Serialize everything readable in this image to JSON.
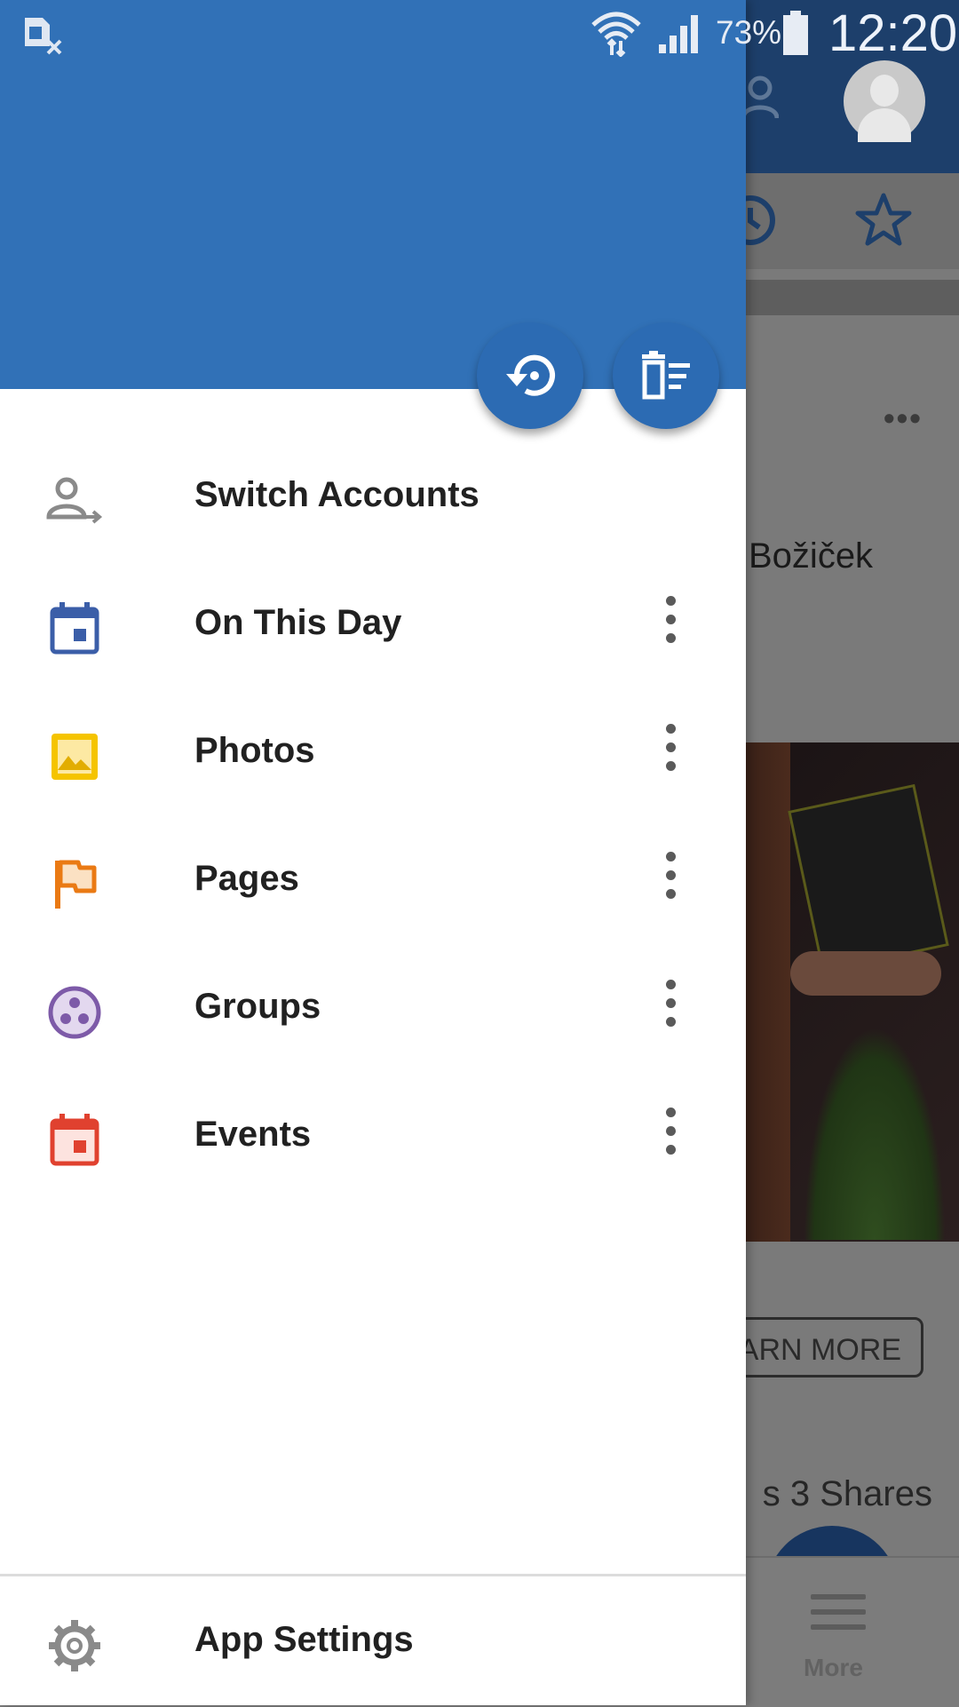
{
  "status_bar": {
    "battery_percent": "73%",
    "time": "12:20"
  },
  "drawer": {
    "header_color": "#3171b7",
    "actions": [
      {
        "icon": "history-icon"
      },
      {
        "icon": "clear-all-icon"
      }
    ],
    "items": [
      {
        "label": "Switch Accounts",
        "icon": "switch-account-icon",
        "color": "#8a8a8a",
        "has_menu": false
      },
      {
        "label": "On This Day",
        "icon": "calendar-icon",
        "color": "#3b5ea8",
        "has_menu": true
      },
      {
        "label": "Photos",
        "icon": "photo-icon",
        "color": "#f5c400",
        "has_menu": true
      },
      {
        "label": "Pages",
        "icon": "flag-icon",
        "color": "#ea7a14",
        "has_menu": true
      },
      {
        "label": "Groups",
        "icon": "groups-icon",
        "color": "#7d5aa8",
        "has_menu": true
      },
      {
        "label": "Events",
        "icon": "event-icon",
        "color": "#e0412f",
        "has_menu": true
      }
    ],
    "footer": {
      "label": "App Settings",
      "icon": "gear-icon"
    }
  },
  "background": {
    "post_name": "Božiček",
    "learn_more": "ARN MORE",
    "stats": "s   3 Shares",
    "bottom_nav_label": "More"
  }
}
